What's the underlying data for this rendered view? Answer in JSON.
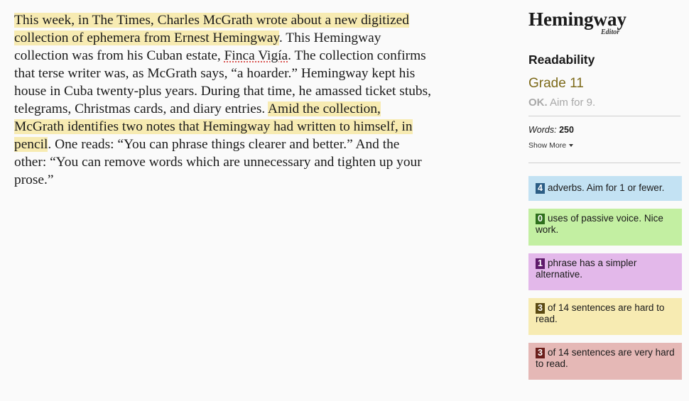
{
  "editor": {
    "segments": [
      {
        "text": "This week, in The Times, Charles McGrath wrote about a new digitized collection of ephemera from Ernest Hemingway",
        "style": "hard"
      },
      {
        "text": ". This Hemingway collection was from his Cuban estate, ",
        "style": "plain"
      },
      {
        "text": "Finca Vigía",
        "style": "spell"
      },
      {
        "text": ". The collection confirms that terse writer was, as McGrath says, “a hoarder.”  Hemingway kept his house in Cuba twenty-plus years. During that time, he amassed ticket stubs, telegrams, Christmas cards, and diary entries. ",
        "style": "plain"
      },
      {
        "text": "Amid the collection, McGrath identifies two notes that Hemingway had written to himself, in pencil",
        "style": "hard"
      },
      {
        "text": ". One reads: “You can phrase things clearer and better.” And the other: “You can remove words which are unnecessary and tighten up your prose.”",
        "style": "plain"
      }
    ]
  },
  "sidebar": {
    "logo_main": "Hemingway",
    "logo_sub": "Editor",
    "readability_title": "Readability",
    "grade": "Grade 11",
    "grade_ok": "OK.",
    "grade_aim": " Aim for 9.",
    "words_label": "Words:",
    "words_count": "250",
    "show_more": "Show More",
    "cards": {
      "adverbs": {
        "count": "4",
        "text": "adverbs. Aim for 1 or fewer."
      },
      "passive": {
        "count": "0",
        "text": "uses of passive voice. Nice work."
      },
      "simpler": {
        "count": "1",
        "text": "phrase has a simpler alternative."
      },
      "hard": {
        "count": "3",
        "text": "of 14 sentences are hard to read."
      },
      "veryhard": {
        "count": "3",
        "text": "of 14 sentences are very hard to read."
      }
    }
  },
  "colors": {
    "hard_highlight": "#f7ebb2",
    "very_hard_highlight": "#e5b8b6",
    "adverb_highlight": "#c3e2f3",
    "passive_highlight": "#c3efa2",
    "simpler_highlight": "#e3b8ea",
    "grade_text": "#7d6a1a"
  }
}
